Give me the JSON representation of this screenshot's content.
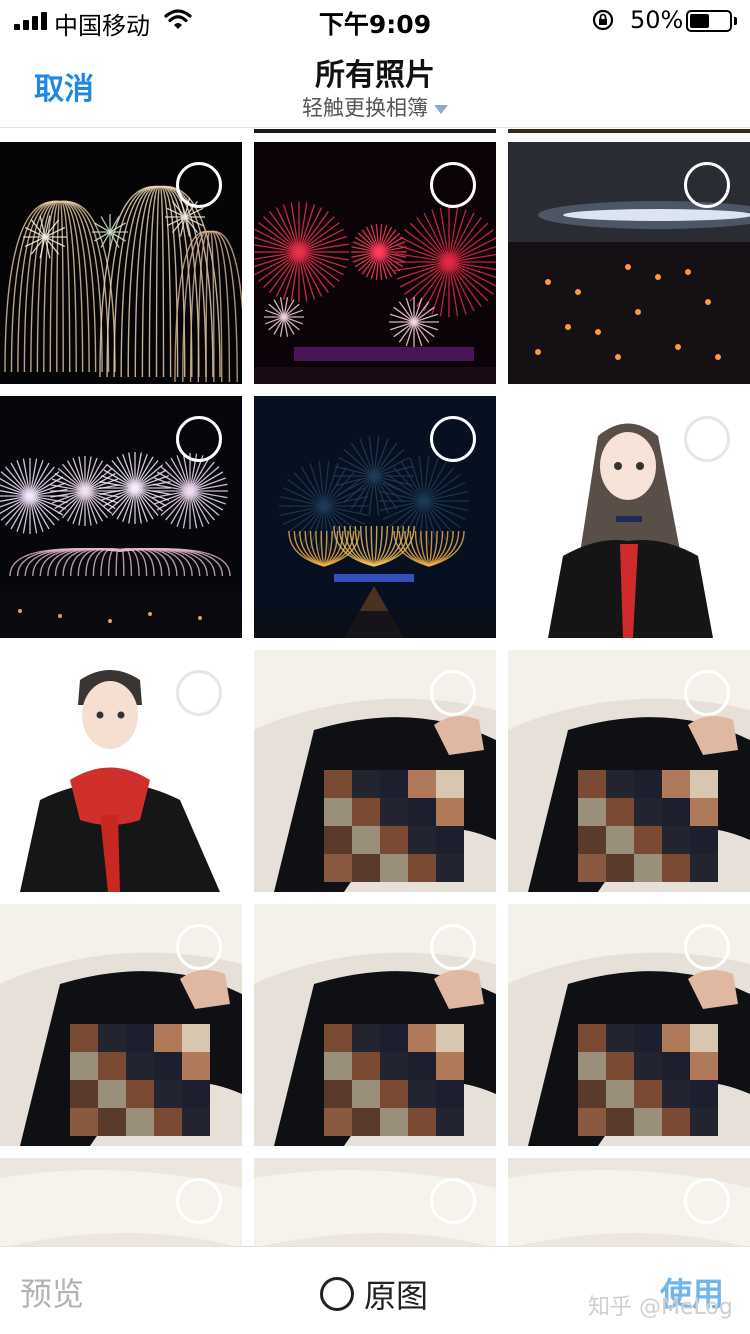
{
  "status_bar": {
    "carrier": "中国移动",
    "time": "下午9:09",
    "battery_percent": "50%",
    "battery_level": 0.5
  },
  "nav": {
    "cancel_label": "取消",
    "title": "所有照片",
    "album_switch_label": "轻触更换相簿"
  },
  "photos": [
    {
      "subject": "fireworks-gold",
      "selected": false
    },
    {
      "subject": "fireworks-red",
      "selected": false
    },
    {
      "subject": "night-harbor-lights",
      "selected": false
    },
    {
      "subject": "fireworks-white",
      "selected": false
    },
    {
      "subject": "fireworks-palace",
      "selected": false
    },
    {
      "subject": "anime-girl",
      "selected": false
    },
    {
      "subject": "anime-boy",
      "selected": false
    },
    {
      "subject": "bed-mosaic",
      "selected": false
    },
    {
      "subject": "bed-mosaic",
      "selected": false
    },
    {
      "subject": "bed-mosaic",
      "selected": false
    },
    {
      "subject": "bed-mosaic",
      "selected": false
    },
    {
      "subject": "bed-mosaic",
      "selected": false
    },
    {
      "subject": "bed-partial",
      "selected": false
    },
    {
      "subject": "bed-partial",
      "selected": false
    },
    {
      "subject": "bed-partial",
      "selected": false
    }
  ],
  "toolbar": {
    "preview_label": "预览",
    "original_label": "原图",
    "use_label": "使用",
    "watermark": "知乎 @MeLog"
  }
}
